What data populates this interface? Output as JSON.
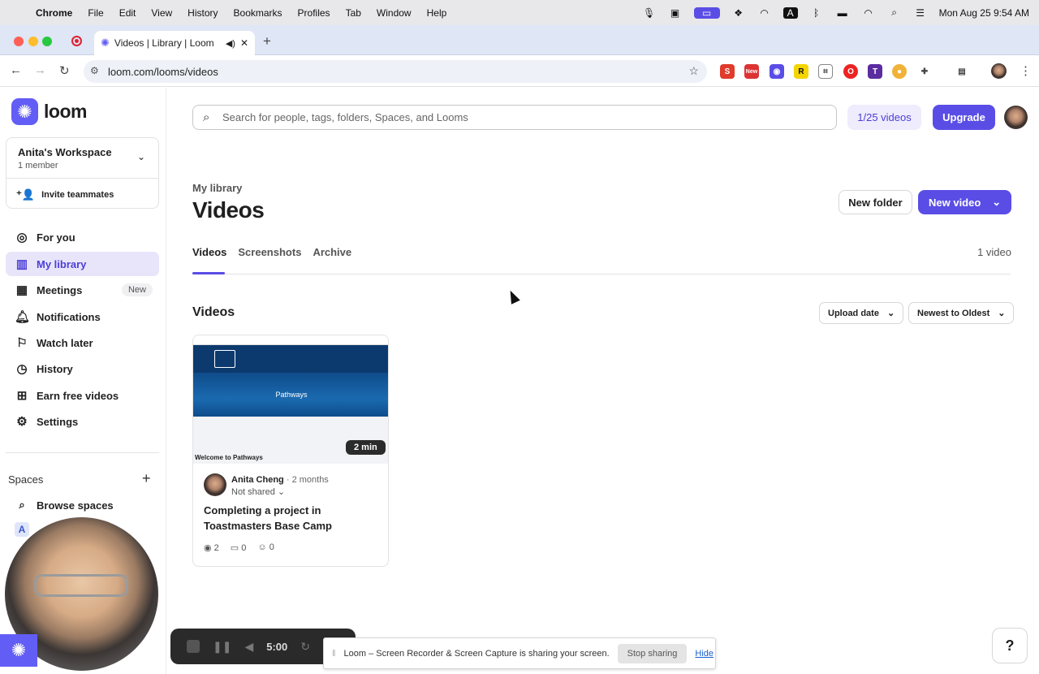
{
  "menubar": {
    "apple": "",
    "items": [
      "Chrome",
      "File",
      "Edit",
      "View",
      "History",
      "Bookmarks",
      "Profiles",
      "Tab",
      "Window",
      "Help"
    ],
    "datetime": "Mon Aug 25  9:54 AM"
  },
  "browser": {
    "tab_title": "Videos | Library | Loom",
    "url": "loom.com/looms/videos"
  },
  "sidebar": {
    "brand": "loom",
    "workspace_name": "Anita's Workspace",
    "workspace_members": "1 member",
    "invite": "Invite teammates",
    "nav": [
      {
        "label": "For you",
        "icon": "user-circle-icon"
      },
      {
        "label": "My library",
        "icon": "library-icon",
        "active": true
      },
      {
        "label": "Meetings",
        "icon": "calendar-icon",
        "badge": "New"
      },
      {
        "label": "Notifications",
        "icon": "bell-icon"
      },
      {
        "label": "Watch later",
        "icon": "bookmark-icon"
      },
      {
        "label": "History",
        "icon": "clock-icon"
      },
      {
        "label": "Earn free videos",
        "icon": "gift-icon"
      },
      {
        "label": "Settings",
        "icon": "gear-icon"
      }
    ],
    "spaces_label": "Spaces",
    "browse_spaces": "Browse spaces",
    "space_initial": "A"
  },
  "header": {
    "search_placeholder": "Search for people, tags, folders, Spaces, and Looms",
    "quota": "1/25 videos",
    "upgrade": "Upgrade"
  },
  "main": {
    "breadcrumb": "My library",
    "title": "Videos",
    "new_folder": "New folder",
    "new_video": "New video",
    "tabs": [
      "Videos",
      "Screenshots",
      "Archive"
    ],
    "video_count": "1 video",
    "section_title": "Videos",
    "sort_field": "Upload date",
    "sort_order": "Newest to Oldest"
  },
  "video": {
    "thumb_banner": "Pathways",
    "thumb_caption": "Welcome to Pathways",
    "duration": "2 min",
    "author": "Anita Cheng",
    "age": "2 months",
    "sharing": "Not shared",
    "title": "Completing a project in Toastmasters Base Camp",
    "views": "2",
    "comments": "0",
    "reactions": "0"
  },
  "recorder": {
    "time": "5:00",
    "share_message": "Loom – Screen Recorder & Screen Capture is sharing your screen.",
    "stop": "Stop sharing",
    "hide": "Hide"
  },
  "help": "?",
  "colors": {
    "accent": "#5a4de6",
    "brand": "#625df5"
  }
}
